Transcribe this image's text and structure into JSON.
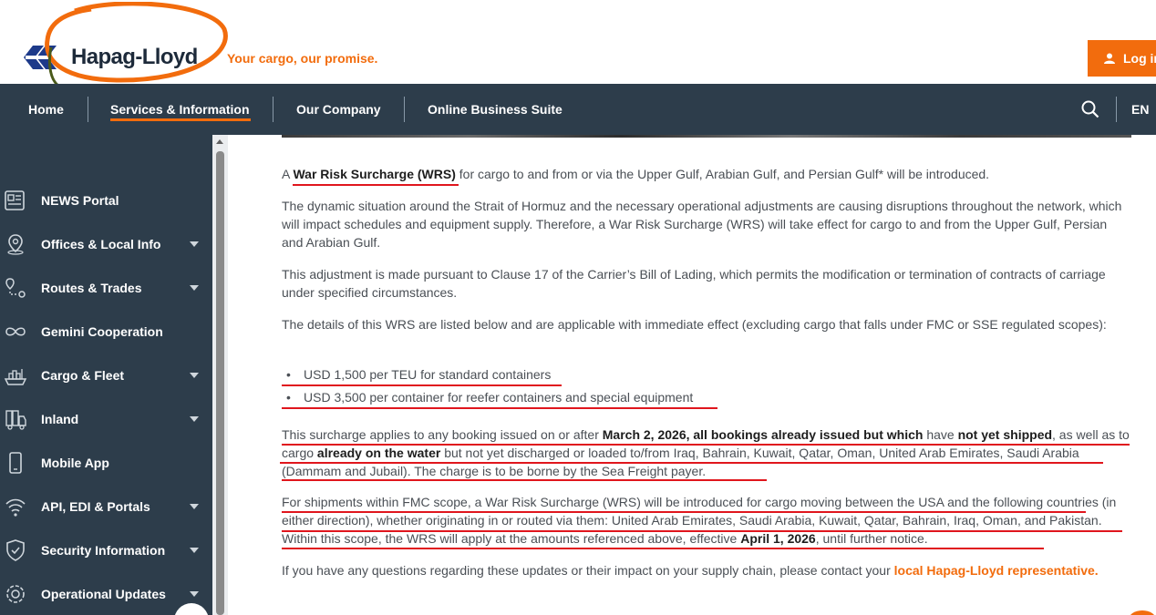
{
  "brand": {
    "name": "Hapag-Lloyd",
    "tagline": "Your cargo, our promise.",
    "accent": "#f26c0d",
    "navy": "#2d3d4b"
  },
  "header": {
    "login_label": "Log in"
  },
  "nav": {
    "items": [
      "Home",
      "Services & Information",
      "Our Company",
      "Online Business Suite"
    ],
    "active": "Services & Information",
    "language": "EN"
  },
  "sidebar": {
    "items": [
      {
        "label": "NEWS Portal",
        "icon": "news-icon",
        "expandable": false
      },
      {
        "label": "Offices & Local Info",
        "icon": "location-pin-icon",
        "expandable": true
      },
      {
        "label": "Routes & Trades",
        "icon": "route-icon",
        "expandable": true
      },
      {
        "label": "Gemini Cooperation",
        "icon": "infinity-icon",
        "expandable": false
      },
      {
        "label": "Cargo & Fleet",
        "icon": "ship-icon",
        "expandable": true
      },
      {
        "label": "Inland",
        "icon": "truck-icon",
        "expandable": true
      },
      {
        "label": "Mobile App",
        "icon": "phone-icon",
        "expandable": false
      },
      {
        "label": "API, EDI & Portals",
        "icon": "wifi-icon",
        "expandable": true
      },
      {
        "label": "Security Information",
        "icon": "shield-icon",
        "expandable": true
      },
      {
        "label": "Operational Updates",
        "icon": "gear-globe-icon",
        "expandable": true
      }
    ]
  },
  "article": {
    "p1_pre": "A ",
    "p1_bold": "War Risk Surcharge (WRS)",
    "p1_post": " for cargo to and from or via the Upper Gulf, Arabian Gulf, and Persian Gulf* will be introduced.",
    "p2": "The dynamic situation around the Strait of Hormuz and the necessary operational adjustments are causing disruptions throughout the network, which will impact schedules and equipment supply. Therefore, a War Risk Surcharge (WRS) will take effect for cargo to and from the Upper Gulf, Persian and Arabian Gulf.",
    "p3": "This adjustment is made pursuant to Clause 17 of the Carrier’s Bill of Lading, which permits the modification or termination of contracts of carriage under specified circumstances.",
    "p4": "The details of this WRS are listed below and are applicable with immediate effect (excluding cargo that falls under FMC or SSE regulated scopes):",
    "bullets": [
      "USD 1,500 per TEU for standard containers",
      "USD 3,500 per container for reefer containers and special equipment"
    ],
    "p5_a": "This surcharge applies to any booking issued on or after ",
    "p5_b": "March 2, 2026, all bookings already issued but which",
    "p5_c": " have ",
    "p5_d": "not yet shipped",
    "p5_e": ", as well as to cargo ",
    "p5_f": "already on the water",
    "p5_g": " but not yet discharged or loaded to/from Iraq, Bahrain, Kuwait, Qatar, Oman, United Arab Emirates, Saudi Arabia (Dammam and Jubail). The charge is to be borne by the Sea Freight payer.",
    "p6_a": "For shipments within FMC scope, a War Risk Surcharge (WRS) will be introduced for cargo moving between the USA and the following countries (in either direction), whether originating in or routed via them: United Arab Emirates, Saudi Arabia, Kuwait, Qatar, Bahrain, Iraq, Oman, and Pakistan. Within this scope, the WRS will apply at the amounts referenced above, effective ",
    "p6_b": "April 1, 2026",
    "p6_c": ", until further notice.",
    "p7_a": "If you have any questions regarding these updates or their impact on your supply chain, please contact your ",
    "p7_link": "local Hapag-Lloyd representative."
  }
}
